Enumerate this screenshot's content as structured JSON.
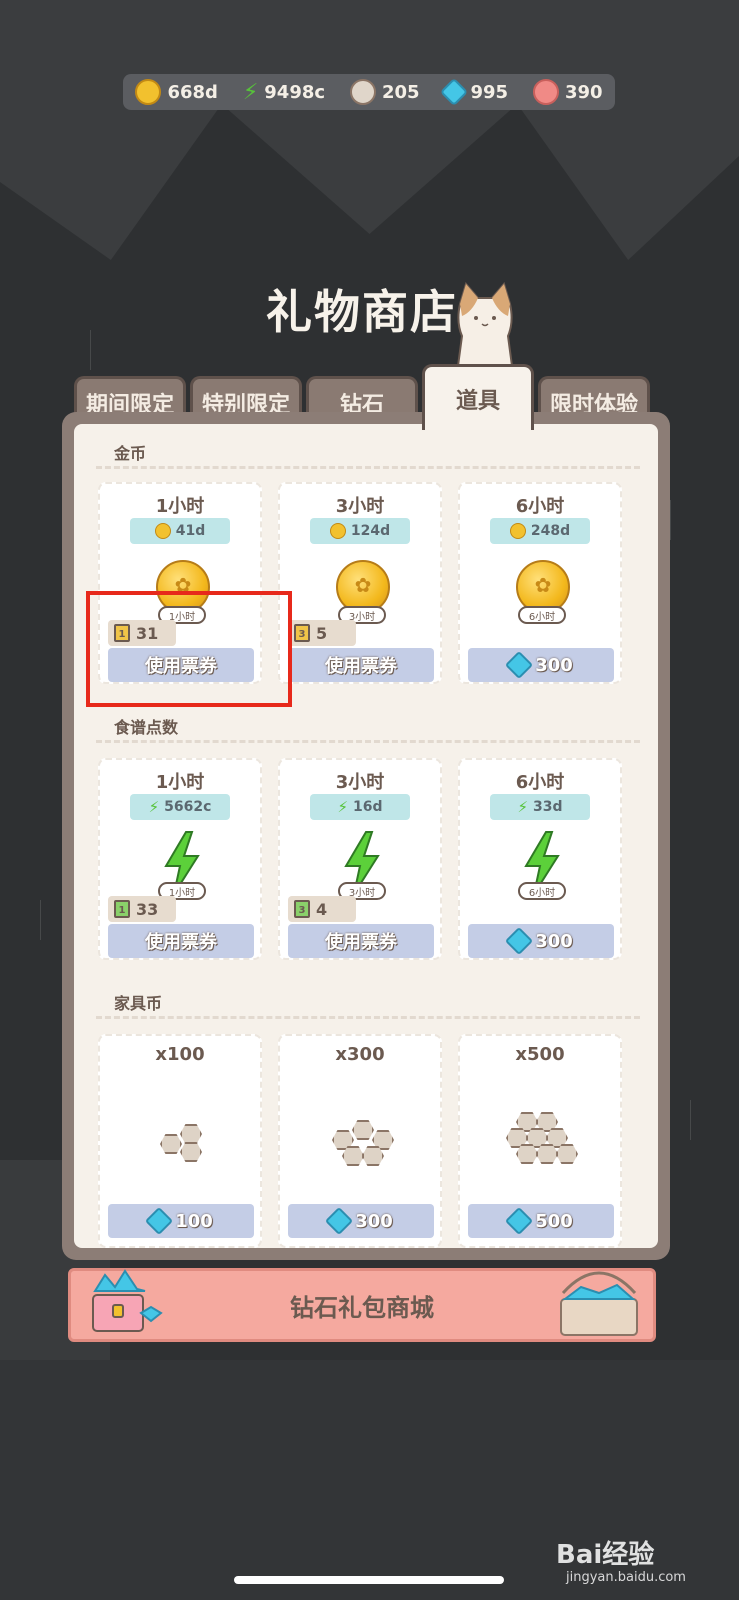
{
  "currencies": [
    {
      "icon": "gold-coin-icon",
      "value": "668d",
      "color": "#f2c12e"
    },
    {
      "icon": "lightning-icon",
      "value": "9498c",
      "color": "#57c23a"
    },
    {
      "icon": "furniture-coin-icon",
      "value": "205",
      "color": "#d6cbbd"
    },
    {
      "icon": "diamond-icon",
      "value": "995",
      "color": "#44c6e6"
    },
    {
      "icon": "pink-shell-icon",
      "value": "390",
      "color": "#f08a86"
    }
  ],
  "title": "礼物商店",
  "tabs": [
    {
      "label": "期间限定",
      "active": false
    },
    {
      "label": "特别限定",
      "active": false
    },
    {
      "label": "钻石",
      "active": false
    },
    {
      "label": "道具",
      "active": true
    },
    {
      "label": "限时体验",
      "active": false
    }
  ],
  "sections": {
    "gold": {
      "label": "金币",
      "cards": [
        {
          "title": "1小时",
          "amount": "41d",
          "duration": "1小时",
          "ticket_count": "31",
          "ticket_level": "1",
          "button": "使用票券"
        },
        {
          "title": "3小时",
          "amount": "124d",
          "duration": "3小时",
          "ticket_count": "5",
          "ticket_level": "3",
          "button": "使用票券"
        },
        {
          "title": "6小时",
          "amount": "248d",
          "duration": "6小时",
          "button": "300"
        }
      ]
    },
    "recipe": {
      "label": "食谱点数",
      "cards": [
        {
          "title": "1小时",
          "amount": "5662c",
          "duration": "1小时",
          "ticket_count": "33",
          "ticket_level": "1",
          "button": "使用票券"
        },
        {
          "title": "3小时",
          "amount": "16d",
          "duration": "3小时",
          "ticket_count": "4",
          "ticket_level": "3",
          "button": "使用票券"
        },
        {
          "title": "6小时",
          "amount": "33d",
          "duration": "6小时",
          "button": "300"
        }
      ]
    },
    "furniture": {
      "label": "家具币",
      "cards": [
        {
          "title": "x100",
          "button": "100"
        },
        {
          "title": "x300",
          "button": "300"
        },
        {
          "title": "x500",
          "button": "500"
        }
      ]
    }
  },
  "banner_label": "钻石礼包商城",
  "watermark": "Bai经验",
  "watermark_sub": "jingyan.baidu.com"
}
